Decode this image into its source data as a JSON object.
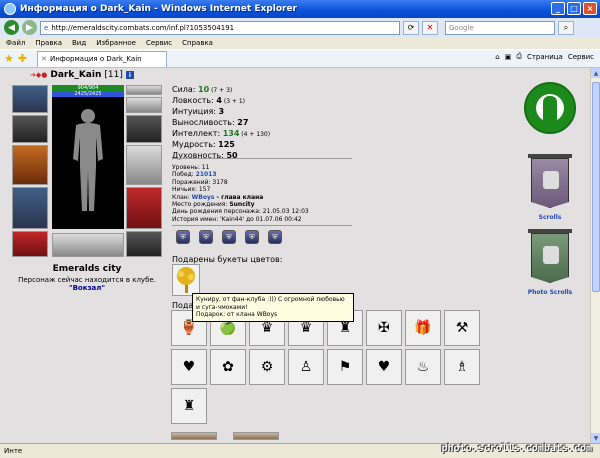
{
  "window": {
    "title": "Информация о Dark_Kain - Windows Internet Explorer"
  },
  "address": {
    "url": "http://emeraldscity.combats.com/inf.pl?1053504191",
    "search_placeholder": "Google"
  },
  "menu": [
    "Файл",
    "Правка",
    "Вид",
    "Избранное",
    "Сервис",
    "Справка"
  ],
  "tab": {
    "label": "Информация о Dark_Kain"
  },
  "toolbar_right": {
    "page": "Страница",
    "service": "Сервис"
  },
  "character": {
    "name": "Dark_Kain",
    "level": "[11]",
    "hp": "904/904",
    "mana": "2425/2425"
  },
  "location": {
    "city": "Emeralds city",
    "note": "Персонаж сейчас находится в клубе.",
    "room": "\"Вокзал\""
  },
  "stats": [
    {
      "label": "Сила: ",
      "value": "10",
      "extra": " (7 + 3)",
      "green": true
    },
    {
      "label": "Ловкость: ",
      "value": "4",
      "extra": " (3 + 1)",
      "green": false
    },
    {
      "label": "Интуиция: ",
      "value": "3",
      "extra": "",
      "green": false
    },
    {
      "label": "Выносливость: ",
      "value": "27",
      "extra": "",
      "green": false
    },
    {
      "label": "Интеллект: ",
      "value": "134",
      "extra": " (4 + 130)",
      "green": true
    },
    {
      "label": "Мудрость: ",
      "value": "125",
      "extra": "",
      "green": false
    },
    {
      "label": "Духовность: ",
      "value": "50",
      "extra": "",
      "green": false
    }
  ],
  "info": {
    "level": "Уровень: 11",
    "wins_label": "Побед: ",
    "wins": "21013",
    "losses": "Поражений: 3178",
    "draws": "Ничьих: 157",
    "clan_label": "Клан: ",
    "clan": "WBoys",
    "clan_role": " - глава клана",
    "birthplace_label": "Место рождения: ",
    "birthplace": "Suncity",
    "birthday": "День рождения персонажа: 21.05.03 12:03",
    "history": "История имен: 'Kain44' до 01.07.06 00:42"
  },
  "flowers": {
    "title": "Подарены букеты цветов:",
    "tooltip_line1": "Куниру, от фан-клуба :))) С огромной любовью и суга-чмоками!",
    "tooltip_line2": "Подарок: от клана WBoys"
  },
  "gifts": {
    "title_visible": "Подар"
  },
  "right_panel": {
    "scrolls_label": "Scrolls",
    "photo_label": "Photo Scrolls"
  },
  "status": {
    "text": "Инте",
    "watermark": "photo.scrolls.combats.com"
  },
  "colors": {
    "accent_green": "#1f7a1f",
    "link_blue": "#1f4bb0",
    "title_blue": "#0a50d8"
  }
}
